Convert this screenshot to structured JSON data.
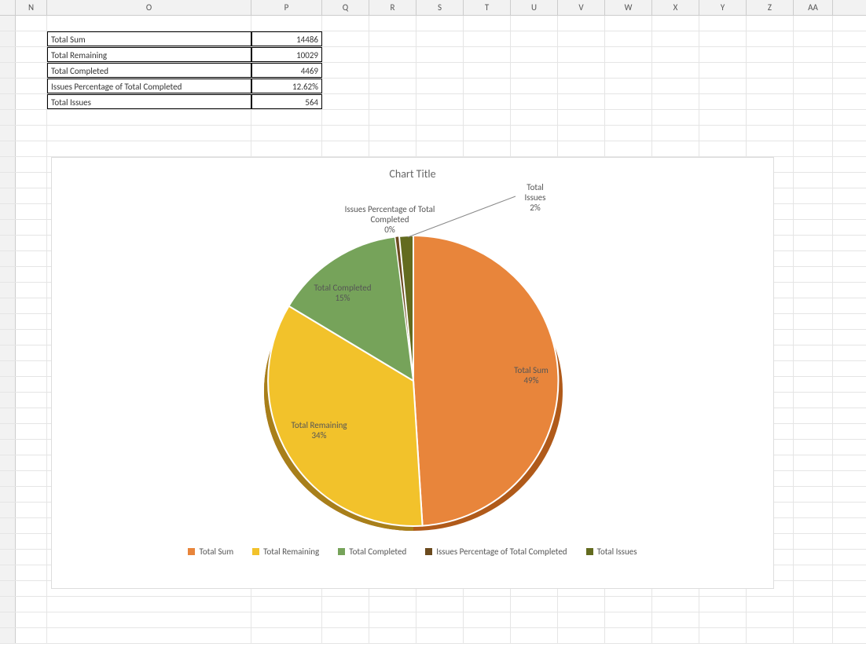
{
  "columns": [
    "N",
    "O",
    "P",
    "Q",
    "R",
    "S",
    "T",
    "U",
    "V",
    "W",
    "X",
    "Y",
    "Z",
    "AA"
  ],
  "table": [
    {
      "label": "Total Sum",
      "value": "14486"
    },
    {
      "label": "Total Remaining",
      "value": "10029"
    },
    {
      "label": "Total Completed",
      "value": "4469"
    },
    {
      "label": "Issues Percentage of Total Completed",
      "value": "12.62%"
    },
    {
      "label": "Total Issues",
      "value": "564"
    }
  ],
  "chart": {
    "title": "Chart Title",
    "legend": [
      "Total Sum",
      "Total Remaining",
      "Total Completed",
      "Issues Percentage of Total Completed",
      "Total Issues"
    ],
    "colors": {
      "Total Sum": "#E8853B",
      "Total Remaining": "#F2C22B",
      "Total Completed": "#76A35A",
      "Issues Percentage of Total Completed": "#6B4A1E",
      "Total Issues": "#636B1F"
    },
    "slice_labels": [
      {
        "text1": "Total Sum",
        "text2": "49%"
      },
      {
        "text1": "Total Remaining",
        "text2": "34%"
      },
      {
        "text1": "Total Completed",
        "text2": "15%"
      },
      {
        "text1": "Issues Percentage of Total",
        "text2": "Completed",
        "text3": "0%"
      },
      {
        "text1": "Total",
        "text2": "Issues",
        "text3": "2%"
      }
    ]
  },
  "chart_data": {
    "type": "pie",
    "title": "Chart Title",
    "categories": [
      "Total Sum",
      "Total Remaining",
      "Total Completed",
      "Issues Percentage of Total Completed",
      "Total Issues"
    ],
    "values": [
      14486,
      10029,
      4469,
      12.62,
      564
    ],
    "percentages": [
      49,
      34,
      15,
      0,
      2
    ],
    "colors": [
      "#E8853B",
      "#F2C22B",
      "#76A35A",
      "#6B4A1E",
      "#636B1F"
    ]
  }
}
